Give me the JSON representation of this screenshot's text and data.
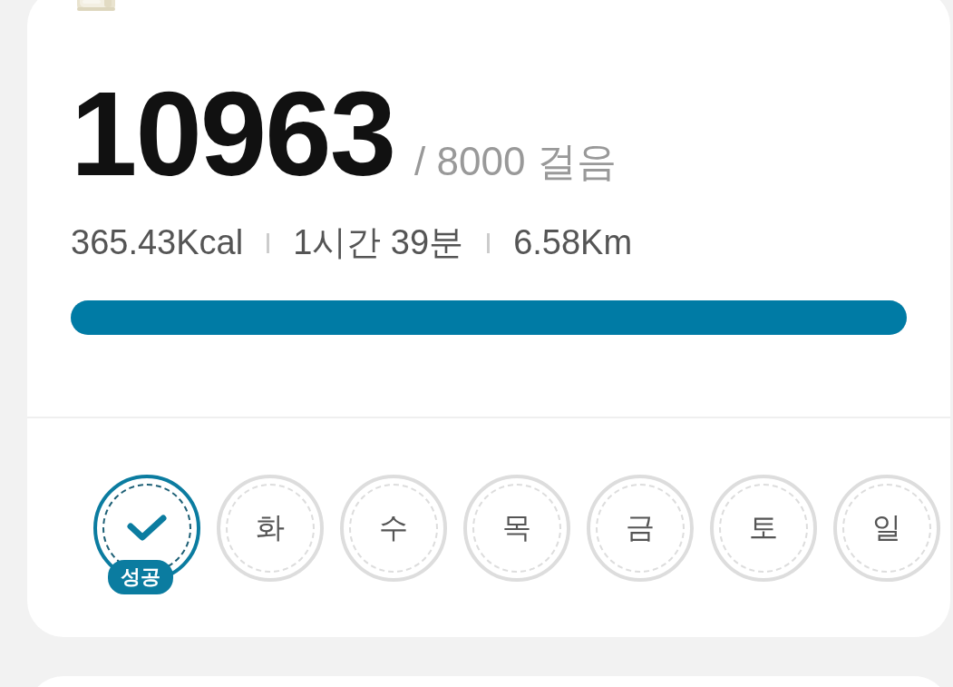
{
  "steps": {
    "count": "10963",
    "goal": "/ 8000 걸음"
  },
  "stats": [
    "365.43Kcal",
    "1시간 39분",
    "6.58Km"
  ],
  "progress": {
    "level": 1.0
  },
  "week": [
    {
      "kind": "success",
      "badge": "성공"
    },
    {
      "kind": "pending",
      "label": "화"
    },
    {
      "kind": "pending",
      "label": "수"
    },
    {
      "kind": "pending",
      "label": "목"
    },
    {
      "kind": "pending",
      "label": "금"
    },
    {
      "kind": "pending",
      "label": "토"
    },
    {
      "kind": "pending",
      "label": "일"
    }
  ]
}
